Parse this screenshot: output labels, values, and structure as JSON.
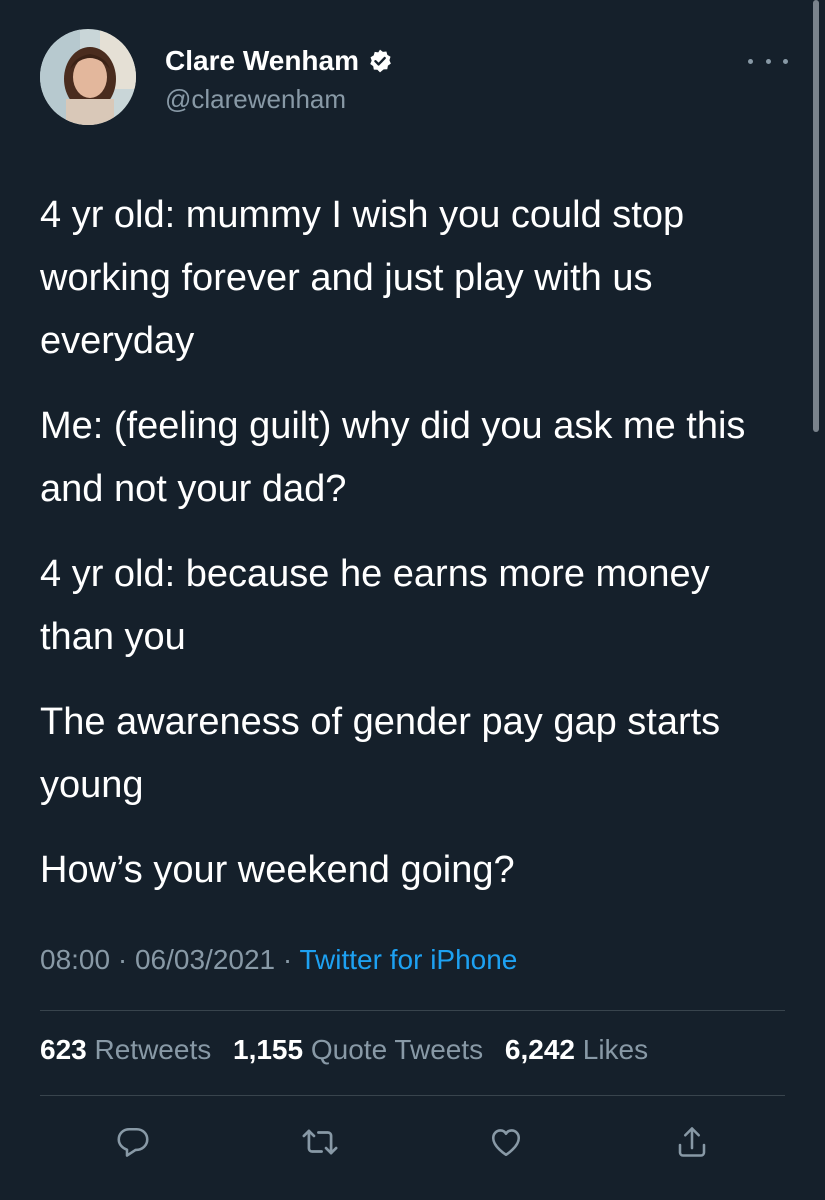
{
  "tweet": {
    "author": {
      "name": "Clare Wenham",
      "handle": "@clarewenham",
      "verified": true
    },
    "paragraphs": [
      "4 yr old: mummy I wish you could stop working forever and just play with us everyday",
      "Me: (feeling guilt) why did you ask me this and not your dad?",
      "4 yr old: because he earns more money than you",
      "The awareness of gender pay gap starts young",
      "How’s your weekend going?"
    ],
    "time": "08:00",
    "separator": " · ",
    "date": "06/03/2021",
    "source": "Twitter for iPhone",
    "stats": {
      "retweets_count": "623",
      "retweets_label": "Retweets",
      "quotes_count": "1,155",
      "quotes_label": "Quote Tweets",
      "likes_count": "6,242",
      "likes_label": "Likes"
    }
  },
  "icons": {
    "reply": "reply-icon",
    "retweet": "retweet-icon",
    "like": "heart-icon",
    "share": "share-icon",
    "more": "more-icon",
    "verified": "verified-badge-icon"
  },
  "colors": {
    "background": "#15202b",
    "text": "#ffffff",
    "secondary": "#8899a6",
    "accent": "#1da1f2",
    "divider": "#38444d"
  }
}
